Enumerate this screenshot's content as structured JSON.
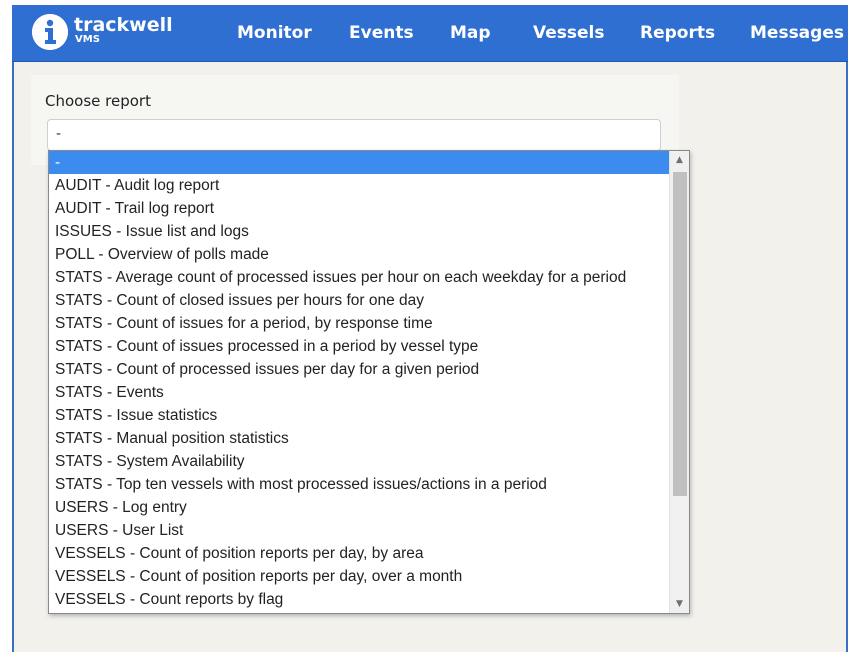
{
  "header": {
    "brand": "trackwell",
    "brand_sub": "VMS",
    "nav": [
      "Monitor",
      "Events",
      "Map",
      "Vessels",
      "Reports",
      "Messages"
    ]
  },
  "form": {
    "label": "Choose report",
    "selected_value": "-"
  },
  "dropdown": {
    "options": [
      "-",
      "AUDIT - Audit log report",
      "AUDIT - Trail log report",
      "ISSUES - Issue list and logs",
      "POLL - Overview of polls made",
      "STATS - Average count of processed issues per hour on each weekday for a period",
      "STATS - Count of closed issues per hours for one day",
      "STATS - Count of issues for a period, by response time",
      "STATS - Count of issues processed in a period by vessel type",
      "STATS - Count of processed issues per day for a given period",
      "STATS - Events",
      "STATS - Issue statistics",
      "STATS - Manual position statistics",
      "STATS - System Availability",
      "STATS - Top ten vessels with most processed issues/actions in a period",
      "USERS - Log entry",
      "USERS - User List",
      "VESSELS - Count of position reports per day, by area",
      "VESSELS - Count of position reports per day, over a month",
      "VESSELS - Count reports by flag"
    ],
    "highlighted_index": 0,
    "scroll_arrow_up": "▲",
    "scroll_arrow_down": "▼"
  },
  "colors": {
    "navbar": "#2f6fd1",
    "highlight": "#3c8cf0",
    "page_bg": "#f2f1ec"
  },
  "icons": {
    "logo": "trackwell-info-logo-icon"
  }
}
